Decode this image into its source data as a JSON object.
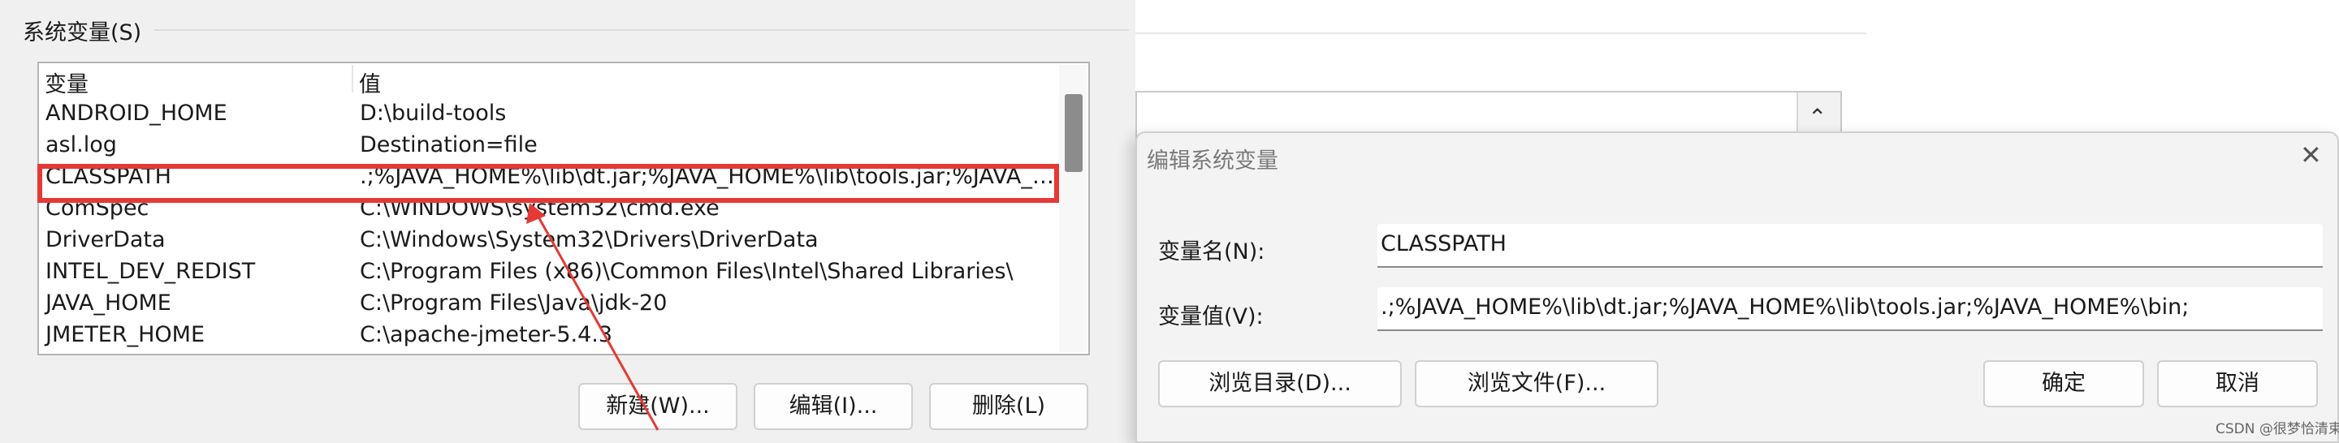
{
  "left_panel": {
    "group_title": "系统变量(S)",
    "columns": {
      "variable": "变量",
      "value": "值"
    },
    "rows": [
      {
        "name": "ANDROID_HOME",
        "value": "D:\\build-tools"
      },
      {
        "name": "asl.log",
        "value": "Destination=file"
      },
      {
        "name": "CLASSPATH",
        "value": ".;%JAVA_HOME%\\lib\\dt.jar;%JAVA_HOME%\\lib\\tools.jar;%JAVA_HOME%\\bin;"
      },
      {
        "name": "ComSpec",
        "value": "C:\\WINDOWS\\system32\\cmd.exe"
      },
      {
        "name": "DriverData",
        "value": "C:\\Windows\\System32\\Drivers\\DriverData"
      },
      {
        "name": "INTEL_DEV_REDIST",
        "value": "C:\\Program Files (x86)\\Common Files\\Intel\\Shared Libraries\\"
      },
      {
        "name": "JAVA_HOME",
        "value": "C:\\Program Files\\Java\\jdk-20"
      },
      {
        "name": "JMETER_HOME",
        "value": "C:\\apache-jmeter-5.4.3"
      }
    ],
    "buttons": {
      "new": "新建(W)...",
      "edit": "编辑(I)...",
      "delete": "删除(L)"
    }
  },
  "background_window": {
    "scroll_up_glyph": "⌃"
  },
  "dialog": {
    "title": "编辑系统变量",
    "close_glyph": "✕",
    "name_label": "变量名(N):",
    "name_value": "CLASSPATH",
    "value_label": "变量值(V):",
    "value_value": ".;%JAVA_HOME%\\lib\\dt.jar;%JAVA_HOME%\\lib\\tools.jar;%JAVA_HOME%\\bin;",
    "buttons": {
      "browse_dir": "浏览目录(D)...",
      "browse_file": "浏览文件(F)...",
      "ok": "确定",
      "cancel": "取消"
    }
  },
  "watermark": "CSDN @很梦恰清束",
  "colors": {
    "highlight": "#e53935",
    "arrow": "#e53935"
  },
  "icons": {
    "close": "close-icon",
    "scroll_up": "chevron-up-icon"
  }
}
